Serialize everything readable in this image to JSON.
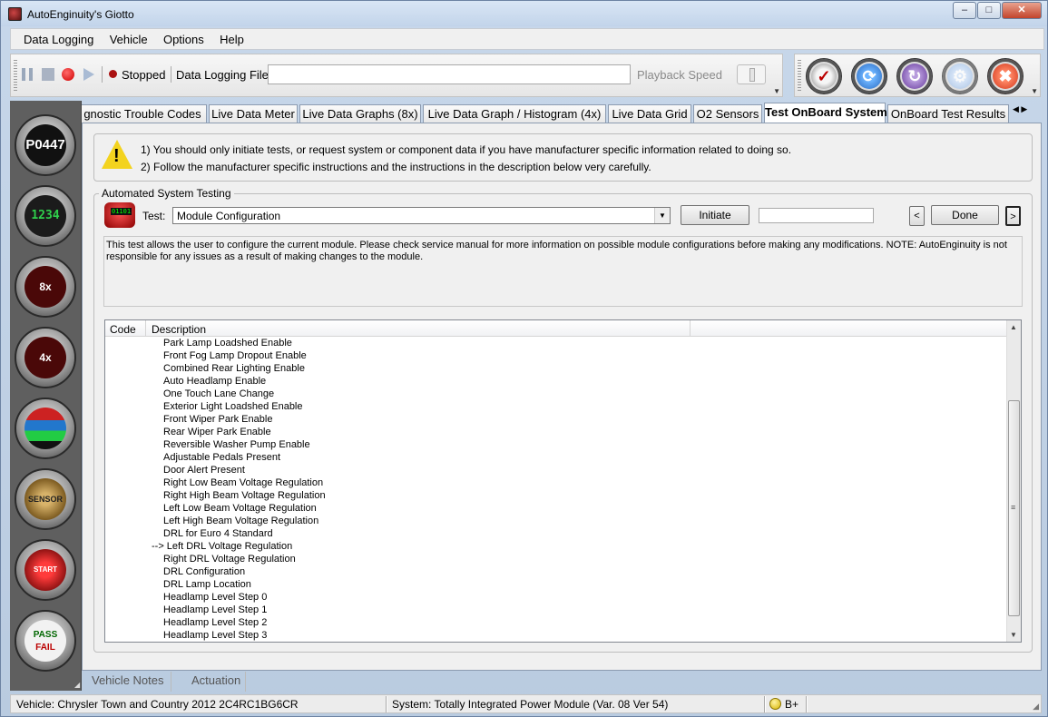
{
  "window": {
    "title": "AutoEnginuity's Giotto"
  },
  "menu": {
    "data_logging": "Data Logging",
    "vehicle": "Vehicle",
    "options": "Options",
    "help": "Help"
  },
  "toolbar": {
    "status": "Stopped",
    "data_logging_file_label": "Data Logging File",
    "data_logging_file_value": "",
    "playback_speed_label": "Playback Speed"
  },
  "sidebar": {
    "dtc_label": "P0447",
    "meter_label": "1234",
    "graph8_label": "8x",
    "graph4_label": "4x",
    "o2_label": "SENSOR",
    "start_label": "START",
    "pass_label": "PASS",
    "fail_label": "FAIL"
  },
  "tabs": [
    {
      "label": "gnostic Trouble Codes"
    },
    {
      "label": "Live Data Meter"
    },
    {
      "label": "Live Data Graphs (8x)"
    },
    {
      "label": "Live Data Graph / Histogram (4x)"
    },
    {
      "label": "Live Data Grid"
    },
    {
      "label": "O2 Sensors"
    },
    {
      "label": "Test OnBoard System"
    },
    {
      "label": "OnBoard Test Results"
    }
  ],
  "warning": {
    "line1": "1) You should only initiate tests, or request system or component data if you have manufacturer specific information related to doing so.",
    "line2": "2) Follow the manufacturer specific instructions and the instructions in the description below very carefully."
  },
  "automated": {
    "group_label": "Automated System Testing",
    "icon_text": "01101",
    "test_label": "Test:",
    "test_value": "Module Configuration",
    "initiate_label": "Initiate",
    "result_value": "",
    "prev_label": "<",
    "done_label": "Done",
    "next_label": ">",
    "description": "This test allows the user to configure the current module. Please check service manual for more information on possible module configurations before making any modifications. NOTE: AutoEnginuity is not responsible for any issues as a result of making changes to the module."
  },
  "list": {
    "col_code": "Code",
    "col_description": "Description",
    "rows": [
      "Park Lamp Loadshed Enable",
      "Front Fog Lamp Dropout Enable",
      "Combined Rear Lighting Enable",
      "Auto Headlamp Enable",
      "One Touch Lane Change",
      "Exterior Light Loadshed Enable",
      "Front Wiper Park Enable",
      "Rear Wiper Park Enable",
      "Reversible Washer Pump Enable",
      "Adjustable Pedals Present",
      "Door Alert Present",
      "Right Low Beam Voltage Regulation",
      "Right High Beam Voltage Regulation",
      "Left Low Beam Voltage Regulation",
      "Left High Beam Voltage Regulation",
      "DRL for Euro 4 Standard",
      "--> Left DRL Voltage Regulation",
      "Right DRL Voltage Regulation",
      "DRL Configuration",
      "DRL Lamp Location",
      "Headlamp Level Step 0",
      "Headlamp Level Step 1",
      "Headlamp Level Step 2",
      "Headlamp Level Step 3"
    ]
  },
  "bottom_tabs": {
    "vehicle_notes": "Vehicle Notes",
    "actuation": "Actuation"
  },
  "status": {
    "vehicle": "Vehicle: Chrysler  Town and Country  2012  2C4RC1BG6CR",
    "system": "System: Totally Integrated Power Module (Var. 08 Ver 54)",
    "grade": "B+"
  }
}
